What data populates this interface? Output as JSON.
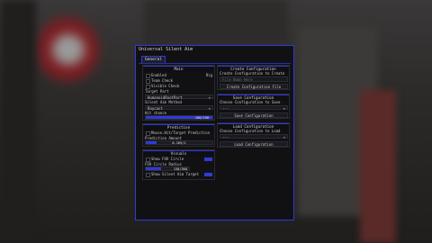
{
  "window": {
    "title": "Universal Silent Aim"
  },
  "tabs": [
    {
      "label": "General"
    }
  ],
  "main": {
    "header": "Main",
    "enabled_label": "Enabled",
    "enabled_key": "Rig",
    "team_check_label": "Team Check",
    "visible_check_label": "Visible Check",
    "target_part_label": "Target Part",
    "target_part_value": "HumanoidRootPart",
    "method_label": "Silent Aim Method",
    "method_value": "Raycast",
    "hit_chance_label": "Hit chance",
    "hit_chance_text": "100/100",
    "hit_chance_value": 100
  },
  "prediction": {
    "header": "Prediction",
    "mouse_hit_label": "Mouse.Hit/Target Prediction",
    "amount_label": "Prediction Amount",
    "amount_text": "0.165/1",
    "amount_value": 0.165
  },
  "visuals": {
    "header": "Visuals",
    "show_fov_label": "Show FOV Circle",
    "fov_radius_label": "FOV Circle Radius",
    "fov_radius_text": "130/360",
    "fov_radius_value": 130,
    "fov_radius_max": 360,
    "show_target_label": "Show Silent Aim Target"
  },
  "create_config": {
    "header": "Create Configuration",
    "prompt": "Create Configuration to Create",
    "placeholder": "File Name Here",
    "button": "Create Configuration File"
  },
  "save_config": {
    "header": "Save Configuration",
    "prompt": "Choose Configuration to Save",
    "dropdown_value": "---",
    "button": "Save Configuration"
  },
  "load_config": {
    "header": "Load Configuration",
    "prompt": "Choose Configuration to Load",
    "dropdown_value": "---",
    "button": "Load Configuration"
  },
  "colors": {
    "accent": "#2f3ad8",
    "window_bg": "#111114"
  }
}
